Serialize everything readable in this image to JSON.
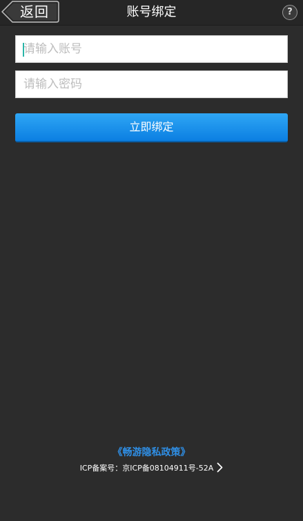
{
  "header": {
    "back_label": "返回",
    "title": "账号绑定",
    "help_label": "?"
  },
  "form": {
    "account_placeholder": "请输入账号",
    "account_value": "",
    "password_placeholder": "请输入密码",
    "password_value": "",
    "submit_label": "立即绑定"
  },
  "footer": {
    "policy_link": "《畅游隐私政策》",
    "icp_text": "ICP备案号：京ICP备08104911号-52A"
  },
  "colors": {
    "background": "#2c2c2c",
    "accent_blue": "#0b7fe2",
    "link_blue": "#2f8fe6"
  },
  "icons": {
    "back": "back-arrow-icon",
    "help": "help-icon",
    "icp_link": "chevron-right-icon"
  }
}
